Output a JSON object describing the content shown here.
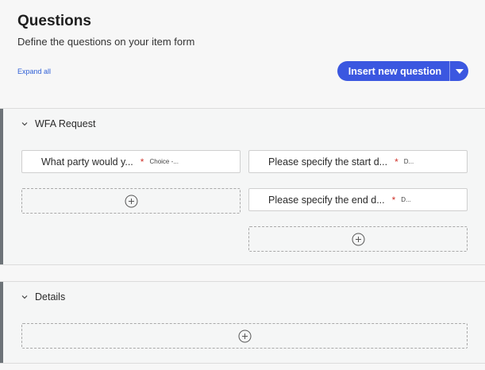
{
  "header": {
    "title": "Questions",
    "subtitle": "Define the questions on your item form",
    "expand_all": "Expand all",
    "insert_button": "Insert new question"
  },
  "sections": [
    {
      "title": "WFA Request",
      "questions": [
        {
          "text": "What party would y...",
          "required": "*",
          "type": "Choice -..."
        },
        {
          "text": "Please specify the start d...",
          "required": "*",
          "type": "D..."
        },
        {
          "text": "Please specify the end d...",
          "required": "*",
          "type": "D..."
        }
      ]
    },
    {
      "title": "Details",
      "questions": []
    }
  ],
  "colors": {
    "accent": "#3b57e0",
    "required": "#d0342c",
    "section_bar": "#6d7378"
  },
  "icons": [
    "chevron-down-icon",
    "plus-circle-icon",
    "caret-down-icon"
  ]
}
